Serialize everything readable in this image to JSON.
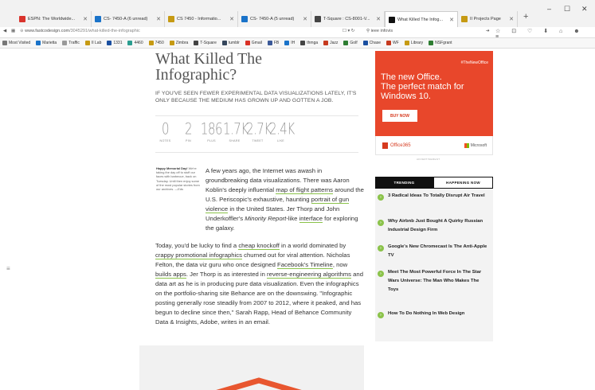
{
  "tabs": [
    {
      "label": "ESPN: The Worldwide...",
      "color": "#d9332c"
    },
    {
      "label": "CS- 7450-A (6 unread)",
      "color": "#1a73c9"
    },
    {
      "label": "CS 7450 - Informatio...",
      "color": "#c69a13"
    },
    {
      "label": "CS- 7450-A (5 unread)",
      "color": "#1a73c9"
    },
    {
      "label": "T-Square : CS-8001-V...",
      "color": "#444444"
    },
    {
      "label": "What Killed The Infog...",
      "color": "#111111"
    },
    {
      "label": "II Projects Page",
      "color": "#c69a13"
    }
  ],
  "nav": {
    "url_host": "www.fastcodesign.com",
    "url_path": "/3045291/what-killed-the-infographic",
    "search_value": "ieee infovis"
  },
  "bookmarks": [
    {
      "label": "Most Visited",
      "color": "#777777"
    },
    {
      "label": "Marietta",
      "color": "#1a73c9"
    },
    {
      "label": "Traffic",
      "color": "#999999"
    },
    {
      "label": "II Lab",
      "color": "#c69a13"
    },
    {
      "label": "1331",
      "color": "#1a4fa0"
    },
    {
      "label": "4460",
      "color": "#2a9d8f"
    },
    {
      "label": "7450",
      "color": "#c69a13"
    },
    {
      "label": "Zimbra",
      "color": "#c69a13"
    },
    {
      "label": "T-Square",
      "color": "#444444"
    },
    {
      "label": "tumblr",
      "color": "#35465c"
    },
    {
      "label": "Gmail",
      "color": "#d93025"
    },
    {
      "label": "FB",
      "color": "#3b5998"
    },
    {
      "label": "IH",
      "color": "#1a73c9"
    },
    {
      "label": "thmga",
      "color": "#444444"
    },
    {
      "label": "Jazz",
      "color": "#c63a1f"
    },
    {
      "label": "Golf",
      "color": "#2e7d32"
    },
    {
      "label": "Chase",
      "color": "#1a4fa0"
    },
    {
      "label": "WF",
      "color": "#c63a1f"
    },
    {
      "label": "Library",
      "color": "#c69a13"
    },
    {
      "label": "NSFgrant",
      "color": "#2e7d32"
    }
  ],
  "article": {
    "headline_l1": "What Killed The",
    "headline_l2": "Infographic?",
    "subhead": "If you've seen fewer experimental data visualizations lately, it's only because the medium has grown up and gotten a job.",
    "stats": [
      {
        "num": "0",
        "label": "NOTES"
      },
      {
        "num": "2",
        "label": "PIN"
      },
      {
        "num": "186",
        "label": "PLUS"
      },
      {
        "num": "1.7K",
        "label": "SHARE"
      },
      {
        "num": "2.7K",
        "label": "TWEET"
      },
      {
        "num": "2.4K",
        "label": "LIKE"
      }
    ],
    "note_title": "Happy Memorial Day!",
    "note_body": "We're taking the day off to stuff our faces with barbecue, back on Tuesday. Until then enjoy some of the most popular stories from our archives. —Eds",
    "p1": {
      "a": "A few years ago, the Internet was awash in groundbreaking data visualizations. There was Aaron Koblin's deeply influential ",
      "link1": "map of flight patterns",
      "b": " around the U.S. Periscopic's exhaustive, haunting ",
      "link2": "portrait of gun violence",
      "c": " in the United States. Jer Thorp and John Underkoffler's ",
      "em": "Minority Report",
      "d": "-like ",
      "link3": "interface",
      "e": " for exploring the galaxy."
    },
    "p2": {
      "a": "Today, you'd be lucky to find a ",
      "link1": "cheap knockoff",
      "b": " in a world dominated by ",
      "link2": "crappy promotional infographics",
      "c": " churned out for viral attention. Nicholas Felton, the data viz guru who once designed ",
      "link3": "Facebook's Timeline",
      "d": ", now ",
      "link4": "builds apps",
      "e": ". Jer Thorp is as interested in ",
      "link5": "reverse-engineering algorithms",
      "f": " and data art as he is in producing pure data visualization. Even the infographics on the portfolio-sharing site Behance are on the downswing. \"Infographic posting generally rose steadily from 2007 to 2012, where it peaked, and has begun to decline since then,\" Sarah Rapp, Head of Behance Community Data & Insights, Adobe, writes in an email."
    }
  },
  "ad": {
    "tag": "#TheNewOffice",
    "line1": "The new Office.",
    "line2": "The perfect match for",
    "line3": "Windows 10.",
    "buy": "BUY NOW",
    "brand": "Office365",
    "msft": "Microsoft",
    "choices": "ADVERTISEMENT",
    "bg": "#e8472b"
  },
  "trending": {
    "tab_on": "TRENDING",
    "tab_off": "HAPPENING NOW",
    "items": [
      "3 Radical Ideas To Totally Disrupt Air Travel",
      "Why Airbnb Just Bought A Quirky Russian Industrial Design Firm",
      "Google's New Chromecast Is The Anti-Apple TV",
      "Meet The Most Powerful Force In The Star Wars Universe: The Man Who Makes The Toys",
      "How To Do Nothing In Web Design"
    ]
  }
}
